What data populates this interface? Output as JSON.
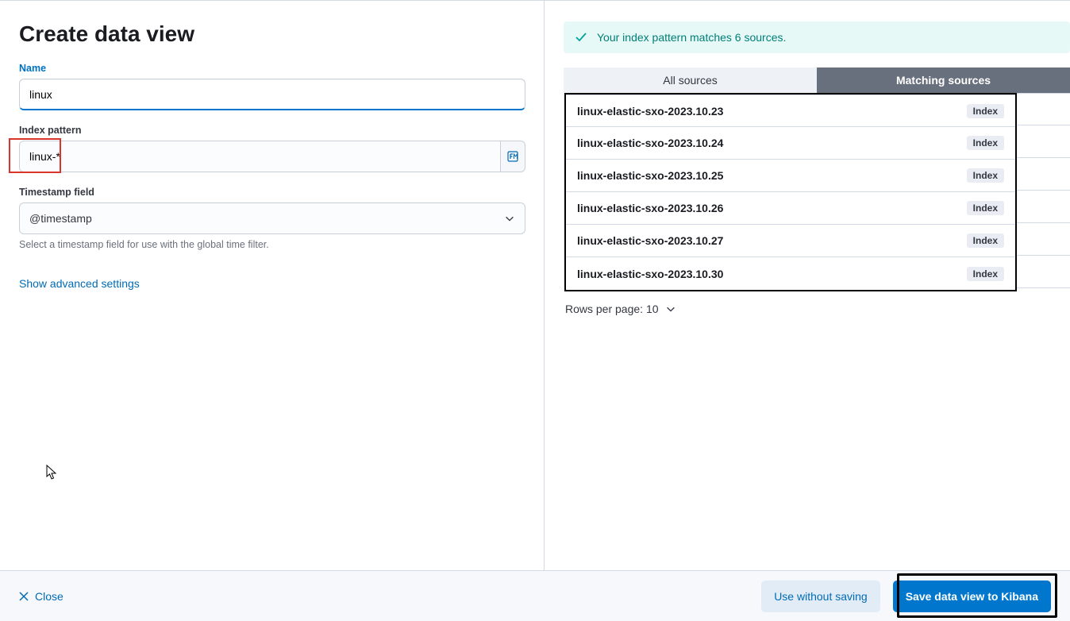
{
  "title": "Create data view",
  "name_field": {
    "label": "Name",
    "value": "linux"
  },
  "pattern_field": {
    "label": "Index pattern",
    "value": "linux-*"
  },
  "timestamp_field": {
    "label": "Timestamp field",
    "value": "@timestamp",
    "help": "Select a timestamp field for use with the global time filter."
  },
  "advanced_link": "Show advanced settings",
  "callout": "Your index pattern matches 6 sources.",
  "tabs": {
    "all": "All sources",
    "matching": "Matching sources"
  },
  "indices": [
    {
      "name": "linux-elastic-sxo-2023.10.23",
      "badge": "Index"
    },
    {
      "name": "linux-elastic-sxo-2023.10.24",
      "badge": "Index"
    },
    {
      "name": "linux-elastic-sxo-2023.10.25",
      "badge": "Index"
    },
    {
      "name": "linux-elastic-sxo-2023.10.26",
      "badge": "Index"
    },
    {
      "name": "linux-elastic-sxo-2023.10.27",
      "badge": "Index"
    },
    {
      "name": "linux-elastic-sxo-2023.10.30",
      "badge": "Index"
    }
  ],
  "rows_per_page": "Rows per page: 10",
  "footer": {
    "close": "Close",
    "use_without": "Use without saving",
    "save": "Save data view to Kibana"
  }
}
